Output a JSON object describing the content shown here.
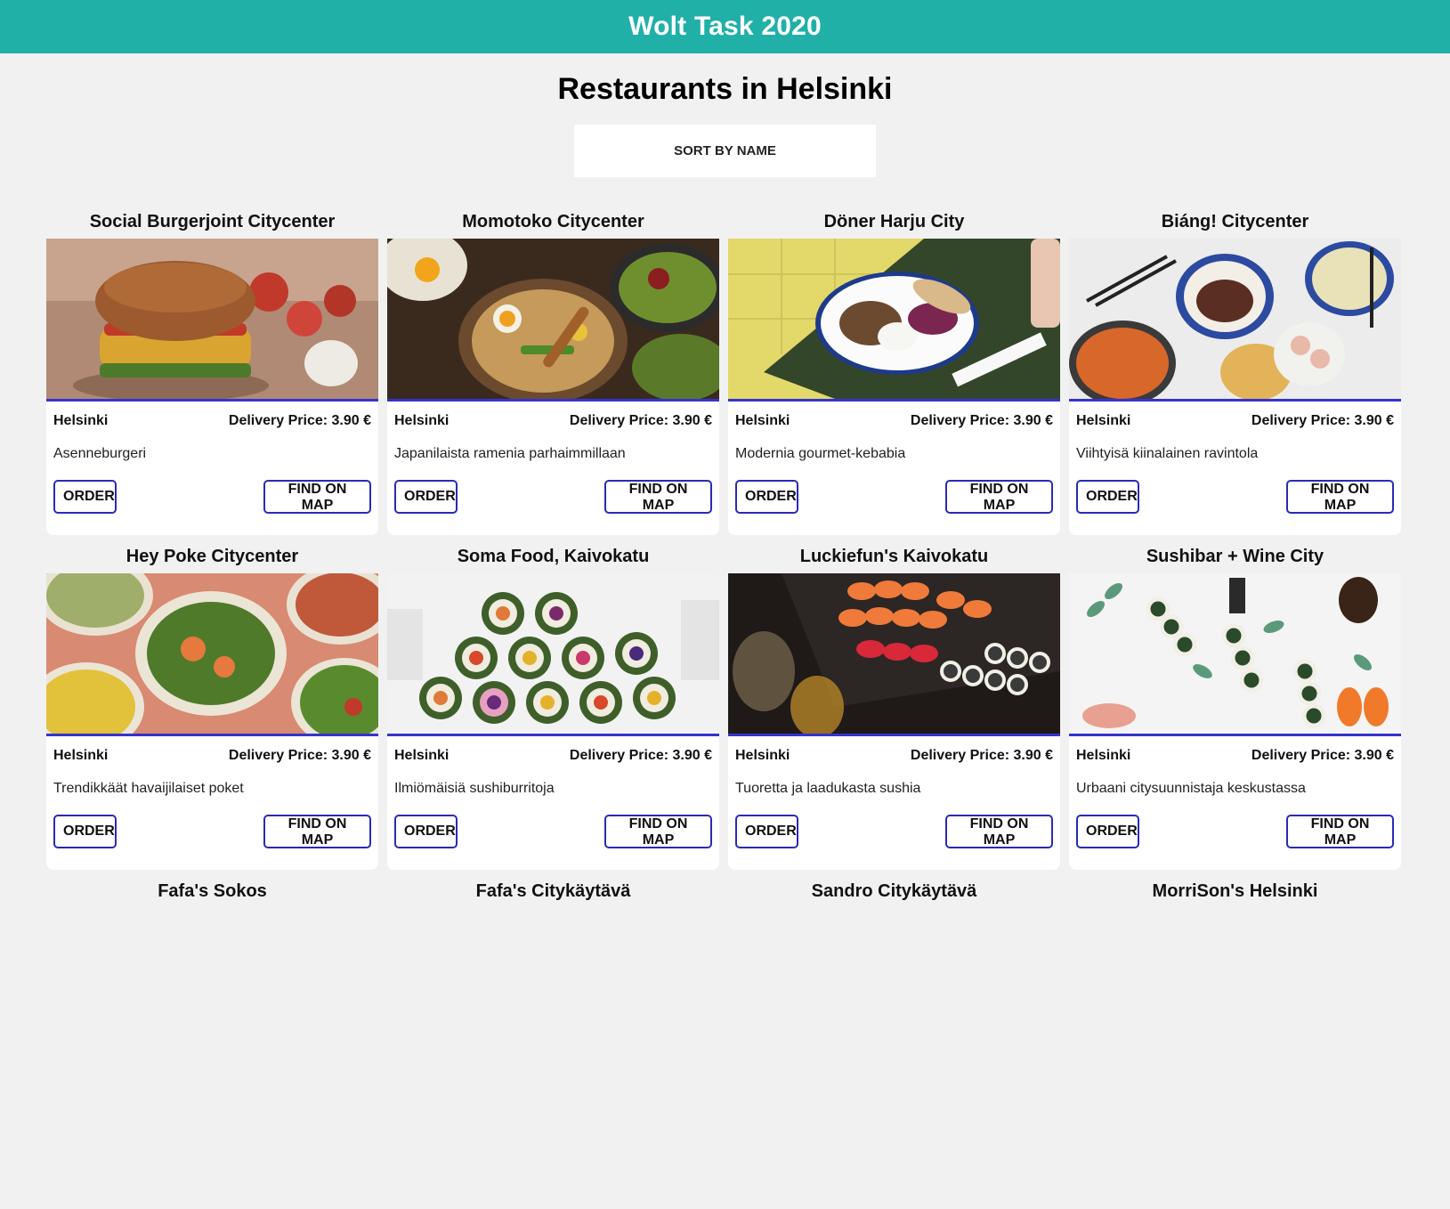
{
  "header": {
    "title": "Wolt Task 2020"
  },
  "page": {
    "title": "Restaurants in Helsinki"
  },
  "sort": {
    "label": "SORT BY NAME"
  },
  "card_labels": {
    "order": "ORDER",
    "find_on_map": "FIND ON MAP"
  },
  "colors": {
    "header_bg": "#21b0a8",
    "accent": "#3434cc",
    "page_bg": "#f1f1f1"
  },
  "restaurants": [
    {
      "name": "Social Burgerjoint Citycenter",
      "city": "Helsinki",
      "delivery": "Delivery Price: 3.90 €",
      "description": "Asenneburgeri",
      "image": "burger-photo"
    },
    {
      "name": "Momotoko Citycenter",
      "city": "Helsinki",
      "delivery": "Delivery Price: 3.90 €",
      "description": "Japanilaista ramenia parhaimmillaan",
      "image": "ramen-photo"
    },
    {
      "name": "Döner Harju City",
      "city": "Helsinki",
      "delivery": "Delivery Price: 3.90 €",
      "description": "Modernia gourmet-kebabia",
      "image": "kebab-plate-photo"
    },
    {
      "name": "Biáng! Citycenter",
      "city": "Helsinki",
      "delivery": "Delivery Price: 3.90 €",
      "description": "Viihtyisä kiinalainen ravintola",
      "image": "chinese-dishes-photo"
    },
    {
      "name": "Hey Poke Citycenter",
      "city": "Helsinki",
      "delivery": "Delivery Price: 3.90 €",
      "description": "Trendikkäät havaijilaiset poket",
      "image": "poke-bowls-photo"
    },
    {
      "name": "Soma Food, Kaivokatu",
      "city": "Helsinki",
      "delivery": "Delivery Price: 3.90 €",
      "description": "Ilmiömäisiä sushiburritoja",
      "image": "sushi-burritos-photo"
    },
    {
      "name": "Luckiefun's Kaivokatu",
      "city": "Helsinki",
      "delivery": "Delivery Price: 3.90 €",
      "description": "Tuoretta ja laadukasta sushia",
      "image": "sushi-platter-photo"
    },
    {
      "name": "Sushibar + Wine City",
      "city": "Helsinki",
      "delivery": "Delivery Price: 3.90 €",
      "description": "Urbaani citysuunnistaja keskustassa",
      "image": "sushi-rolls-photo"
    },
    {
      "name": "Fafa's Sokos",
      "city": "",
      "delivery": "",
      "description": "",
      "image": ""
    },
    {
      "name": "Fafa's Citykäytävä",
      "city": "",
      "delivery": "",
      "description": "",
      "image": ""
    },
    {
      "name": "Sandro Citykäytävä",
      "city": "",
      "delivery": "",
      "description": "",
      "image": ""
    },
    {
      "name": "MorriSon's Helsinki",
      "city": "",
      "delivery": "",
      "description": "",
      "image": ""
    }
  ]
}
